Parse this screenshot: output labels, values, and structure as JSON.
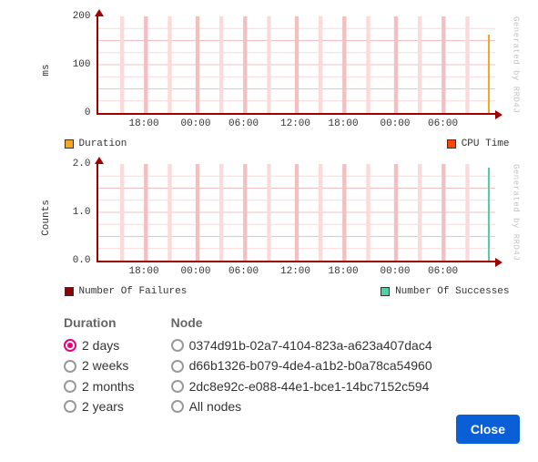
{
  "chart_data": [
    {
      "type": "line",
      "ylabel": "ms",
      "ylim": [
        0,
        200
      ],
      "yticks": [
        0,
        100,
        200
      ],
      "x": [
        "18:00",
        "00:00",
        "06:00",
        "12:00",
        "18:00",
        "00:00",
        "06:00"
      ],
      "series": [
        {
          "name": "Duration",
          "color": "#f5a623",
          "values": []
        },
        {
          "name": "CPU Time",
          "color": "#ff4500",
          "values": []
        }
      ],
      "watermark": "Generated by RRD4J"
    },
    {
      "type": "line",
      "ylabel": "Counts",
      "ylim": [
        0.0,
        2.0
      ],
      "yticks": [
        0.0,
        1.0,
        2.0
      ],
      "x": [
        "18:00",
        "00:00",
        "06:00",
        "12:00",
        "18:00",
        "00:00",
        "06:00"
      ],
      "series": [
        {
          "name": "Number Of Failures",
          "color": "#8b0000",
          "values": []
        },
        {
          "name": "Number Of Successes",
          "color": "#4fd1a5",
          "values": []
        }
      ],
      "watermark": "Generated by RRD4J"
    }
  ],
  "chart1": {
    "ylabel": "ms",
    "ytick0": "0",
    "ytick1": "100",
    "ytick2": "200",
    "watermark": "Generated by RRD4J",
    "legendL": "Duration",
    "legendR": "CPU Time"
  },
  "chart2": {
    "ylabel": "Counts",
    "ytick0": "0.0",
    "ytick1": "1.0",
    "ytick2": "2.0",
    "watermark": "Generated by RRD4J",
    "legendL": "Number Of Failures",
    "legendR": "Number Of Successes"
  },
  "xticks": {
    "t0": "18:00",
    "t1": "00:00",
    "t2": "06:00",
    "t3": "12:00",
    "t4": "18:00",
    "t5": "00:00",
    "t6": "06:00"
  },
  "controls": {
    "duration_header": "Duration",
    "node_header": "Node",
    "duration": [
      "2 days",
      "2 weeks",
      "2 months",
      "2 years"
    ],
    "duration_selected": 0,
    "nodes": [
      "0374d91b-02a7-4104-823a-a623a407dac4",
      "d66b1326-b079-4de4-a1b2-b0a78ca54960",
      "2dc8e92c-e088-44e1-bce1-14bc7152c594",
      "All nodes"
    ],
    "node_selected": -1
  },
  "footer": {
    "close_label": "Close"
  },
  "colors": {
    "duration_swatch": "#f5a623",
    "cputime_swatch": "#ff4500",
    "failures_swatch": "#8b0000",
    "successes_swatch": "#4fd1a5"
  }
}
